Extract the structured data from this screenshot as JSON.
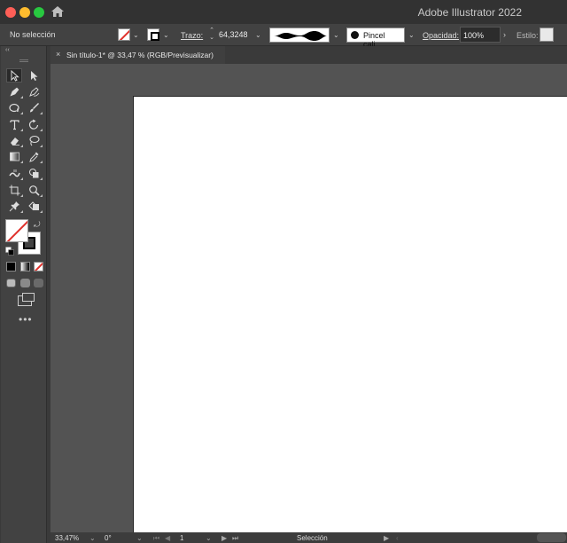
{
  "window": {
    "app_title": "Adobe Illustrator 2022"
  },
  "control_bar": {
    "selection_status": "No selección",
    "stroke_label": "Trazo:",
    "stroke_weight": "64,3248",
    "brush_name": "Pincel cali...",
    "opacity_label": "Opacidad:",
    "opacity_value": "100%",
    "style_label": "Estilo:"
  },
  "document_tab": {
    "title": "Sin título-1* @ 33,47 % (RGB/Previsualizar)",
    "close_glyph": "×"
  },
  "toolbar": {
    "tools": [
      {
        "name": "selection-tool",
        "glyph": "▷"
      },
      {
        "name": "direct-selection-tool",
        "glyph": "▶"
      },
      {
        "name": "pen-tool",
        "glyph": "✒"
      },
      {
        "name": "curvature-tool",
        "glyph": "✑"
      },
      {
        "name": "ellipse-tool",
        "glyph": "○"
      },
      {
        "name": "paintbrush-tool",
        "glyph": "🖌"
      },
      {
        "name": "type-tool",
        "glyph": "T"
      },
      {
        "name": "rotate-tool",
        "glyph": "↺"
      },
      {
        "name": "eraser-tool",
        "glyph": "⌫"
      },
      {
        "name": "lasso-tool",
        "glyph": "⌕"
      },
      {
        "name": "gradient-tool",
        "glyph": "▣"
      },
      {
        "name": "eyedropper-tool",
        "glyph": "✎"
      },
      {
        "name": "width-tool",
        "glyph": "≋"
      },
      {
        "name": "shape-builder-tool",
        "glyph": "⧉"
      },
      {
        "name": "artboard-tool",
        "glyph": "⌗"
      },
      {
        "name": "zoom-tool",
        "glyph": "⚲"
      },
      {
        "name": "puppet-warp-tool",
        "glyph": "✦"
      },
      {
        "name": "live-paint-bucket-tool",
        "glyph": "◈"
      }
    ],
    "more_glyph": "•••"
  },
  "status_bar": {
    "zoom": "33,47%",
    "rotation": "0°",
    "artboard_number": "1",
    "status_text": "Selección"
  },
  "colors": {
    "chrome_dark": "#323232",
    "panel": "#424242",
    "canvas_bg": "#535353",
    "artboard": "#ffffff",
    "none_slash": "#e0302b"
  }
}
